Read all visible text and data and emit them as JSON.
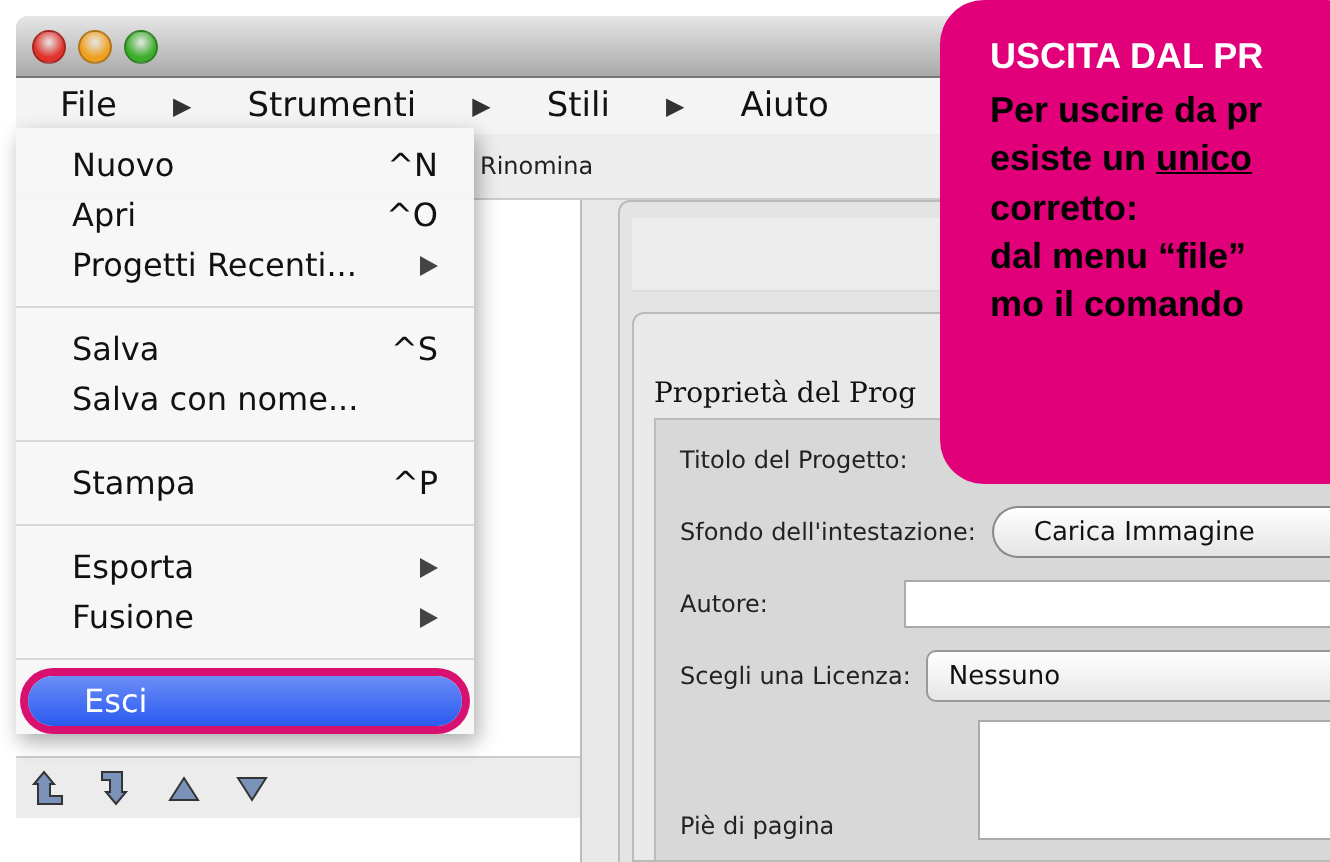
{
  "menubar": [
    "File",
    "▶",
    "Strumenti",
    "▶",
    "Stili",
    "▶",
    "Aiuto"
  ],
  "toolbar": {
    "label": "Rinomina"
  },
  "file_menu": [
    [
      {
        "label": "Nuovo",
        "shortcut": "^N",
        "submenu": false,
        "selected": false
      },
      {
        "label": "Apri",
        "shortcut": "^O",
        "submenu": false,
        "selected": false
      },
      {
        "label": "Progetti Recenti...",
        "submenu": true,
        "selected": false
      }
    ],
    [
      {
        "label": "Salva",
        "shortcut": "^S",
        "submenu": false,
        "selected": false
      },
      {
        "label": "Salva con nome...",
        "submenu": false,
        "selected": false
      }
    ],
    [
      {
        "label": "Stampa",
        "shortcut": "^P",
        "submenu": false,
        "selected": false
      }
    ],
    [
      {
        "label": "Esporta",
        "submenu": true,
        "selected": false
      },
      {
        "label": "Fusione",
        "submenu": true,
        "selected": false
      }
    ],
    [
      {
        "label": "Esci",
        "submenu": false,
        "selected": true
      }
    ]
  ],
  "properties": {
    "title": "Proprietà del Prog",
    "rows": [
      {
        "kind": "blank",
        "label": "Titolo del Progetto:"
      },
      {
        "kind": "button",
        "label": "Sfondo dell'intestazione:",
        "value": "Carica Immagine"
      },
      {
        "kind": "input",
        "label": "Autore:"
      },
      {
        "kind": "select",
        "label": "Scegli una Licenza:",
        "value": "Nessuno"
      },
      {
        "kind": "textarea",
        "label": "Piè di pagina"
      }
    ]
  },
  "callout": {
    "title": "USCITA DAL PR",
    "lines": [
      [
        {
          "text": "Per uscire da pr",
          "underlined": false
        }
      ],
      [
        {
          "text": "esiste un ",
          "underlined": false
        },
        {
          "text": "unico",
          "underlined": true
        }
      ],
      [
        {
          "text": "corretto:",
          "underlined": false
        }
      ],
      [
        {
          "text": "dal menu “file”",
          "underlined": false
        }
      ],
      [
        {
          "text": "mo il comando",
          "underlined": false
        }
      ]
    ]
  }
}
